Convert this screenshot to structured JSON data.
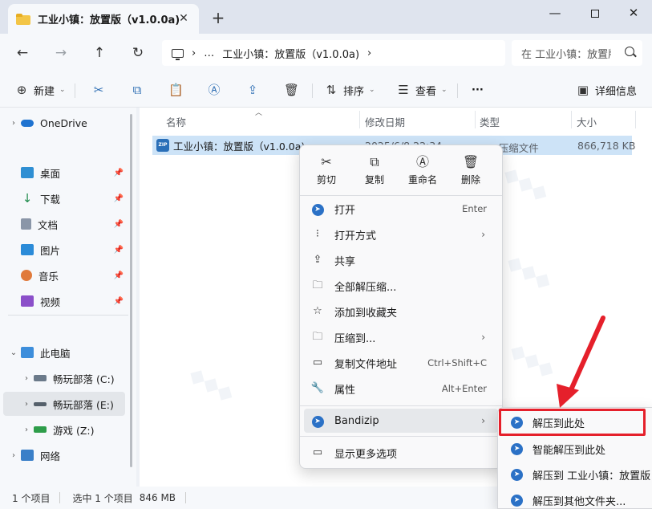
{
  "tab": {
    "title": "工业小镇：放置版（v1.0.0a)",
    "close": "✕",
    "new": "+"
  },
  "window": {
    "minimize": "—",
    "maximize": "",
    "close": "✕"
  },
  "nav": {
    "back": "←",
    "forward": "→",
    "up": "↑",
    "refresh": "↻"
  },
  "address": {
    "more": "…",
    "sep1": "›",
    "path": "工业小镇：放置版（v1.0.0a)",
    "sep2": "›"
  },
  "search": {
    "placeholder": "在 工业小镇：放置版"
  },
  "toolbar": {
    "new_label": "新建",
    "sort_label": "排序",
    "view_label": "查看",
    "more_label": "···",
    "details_label": "详细信息"
  },
  "sidebar": {
    "onedrive": "OneDrive",
    "desktop": "桌面",
    "downloads": "下载",
    "documents": "文档",
    "pictures": "图片",
    "music": "音乐",
    "videos": "视频",
    "thispc": "此电脑",
    "drive_c": "畅玩部落 (C:)",
    "drive_e": "畅玩部落 (E:)",
    "drive_z": "游戏 (Z:)",
    "network": "网络"
  },
  "columns": {
    "name": "名称",
    "date": "修改日期",
    "type": "类型",
    "size": "大小"
  },
  "file": {
    "name": "工业小镇：放置版（v1.0.0a)",
    "date": "2025/6/8 22:34",
    "type": "ZIP 压缩文件",
    "size": "866,718 KB"
  },
  "status": {
    "items": "1 个项目",
    "selected": "选中 1 个项目",
    "size": "846 MB"
  },
  "context_menu": {
    "quick": {
      "cut": "剪切",
      "copy": "复制",
      "rename": "重命名",
      "delete": "删除"
    },
    "open": "打开",
    "open_sc": "Enter",
    "open_with": "打开方式",
    "share": "共享",
    "extract_all": "全部解压缩...",
    "add_fav": "添加到收藏夹",
    "compress_to": "压缩到...",
    "copy_path": "复制文件地址",
    "copy_path_sc": "Ctrl+Shift+C",
    "properties": "属性",
    "properties_sc": "Alt+Enter",
    "bandizip": "Bandizip",
    "more_options": "显示更多选项"
  },
  "submenu": {
    "extract_here": "解压到此处",
    "smart_extract": "智能解压到此处",
    "extract_to_folder": "解压到 工业小镇：放置版",
    "extract_other": "解压到其他文件夹..."
  },
  "colors": {
    "accent": "#2b71c6",
    "highlight": "#e5202b",
    "selection": "#cde3f7"
  }
}
